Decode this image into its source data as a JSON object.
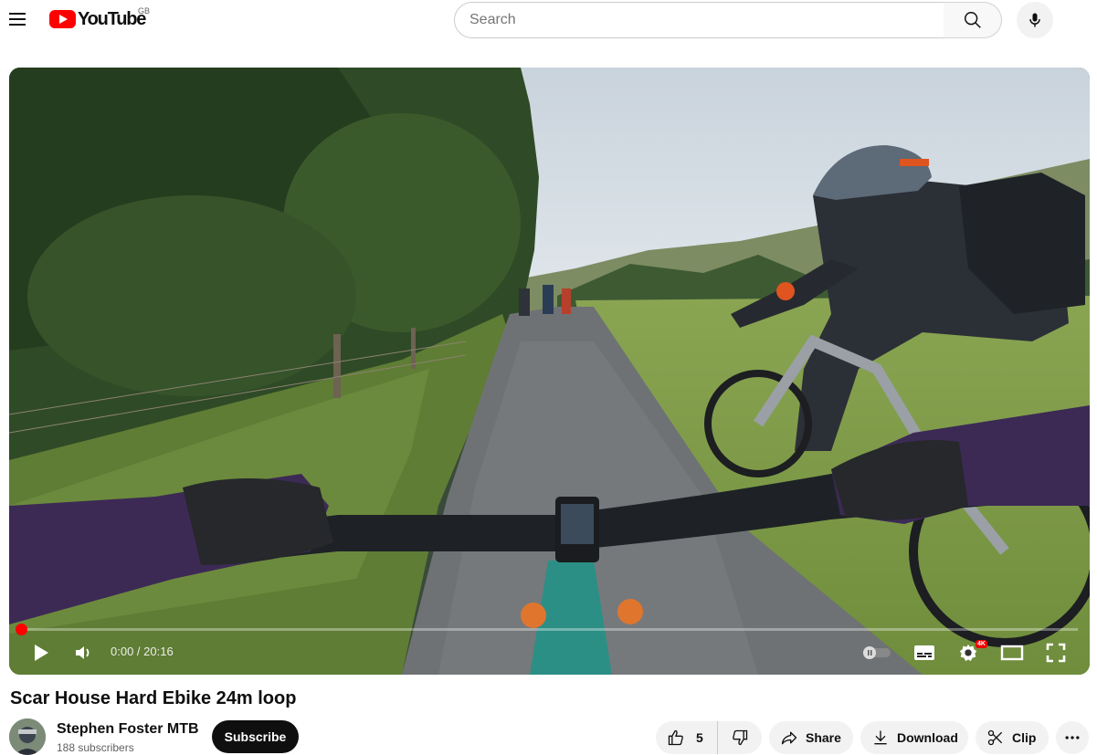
{
  "header": {
    "logo_text": "YouTube",
    "region": "GB",
    "search_placeholder": "Search"
  },
  "player": {
    "time_display": "0:00 / 20:16",
    "quality_badge": "4K",
    "progress": 0
  },
  "video": {
    "title": "Scar House Hard Ebike 24m loop"
  },
  "channel": {
    "name": "Stephen Foster MTB",
    "subscribers": "188 subscribers",
    "subscribe_label": "Subscribe"
  },
  "actions": {
    "likes": "5",
    "share_label": "Share",
    "download_label": "Download",
    "clip_label": "Clip"
  },
  "colors": {
    "brand_red": "#ff0000",
    "text_primary": "#0f0f0f",
    "text_secondary": "#606060",
    "pill_bg": "#f2f2f2"
  },
  "icons": [
    "menu-icon",
    "youtube-logo-icon",
    "search-icon",
    "microphone-icon",
    "play-icon",
    "volume-icon",
    "autoplay-toggle-icon",
    "subtitles-icon",
    "settings-icon",
    "theater-mode-icon",
    "fullscreen-icon",
    "like-icon",
    "dislike-icon",
    "share-icon",
    "download-icon",
    "clip-icon",
    "more-icon"
  ]
}
